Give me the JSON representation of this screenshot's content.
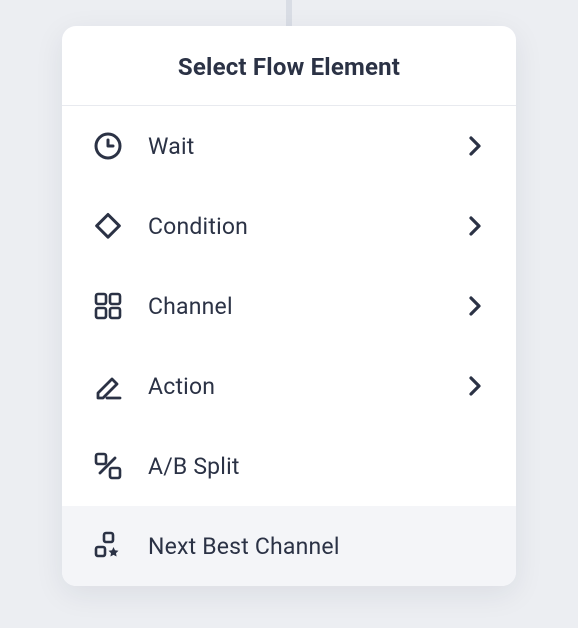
{
  "header": {
    "title": "Select Flow Element"
  },
  "items": [
    {
      "label": "Wait",
      "icon": "clock",
      "hasChildren": true,
      "highlight": false
    },
    {
      "label": "Condition",
      "icon": "diamond",
      "hasChildren": true,
      "highlight": false
    },
    {
      "label": "Channel",
      "icon": "grid",
      "hasChildren": true,
      "highlight": false
    },
    {
      "label": "Action",
      "icon": "pencil",
      "hasChildren": true,
      "highlight": false
    },
    {
      "label": "A/B Split",
      "icon": "absplit",
      "hasChildren": false,
      "highlight": false
    },
    {
      "label": "Next Best Channel",
      "icon": "nextbest",
      "hasChildren": false,
      "highlight": true
    }
  ],
  "colors": {
    "text": "#2b3245",
    "stroke": "#2b3245"
  }
}
